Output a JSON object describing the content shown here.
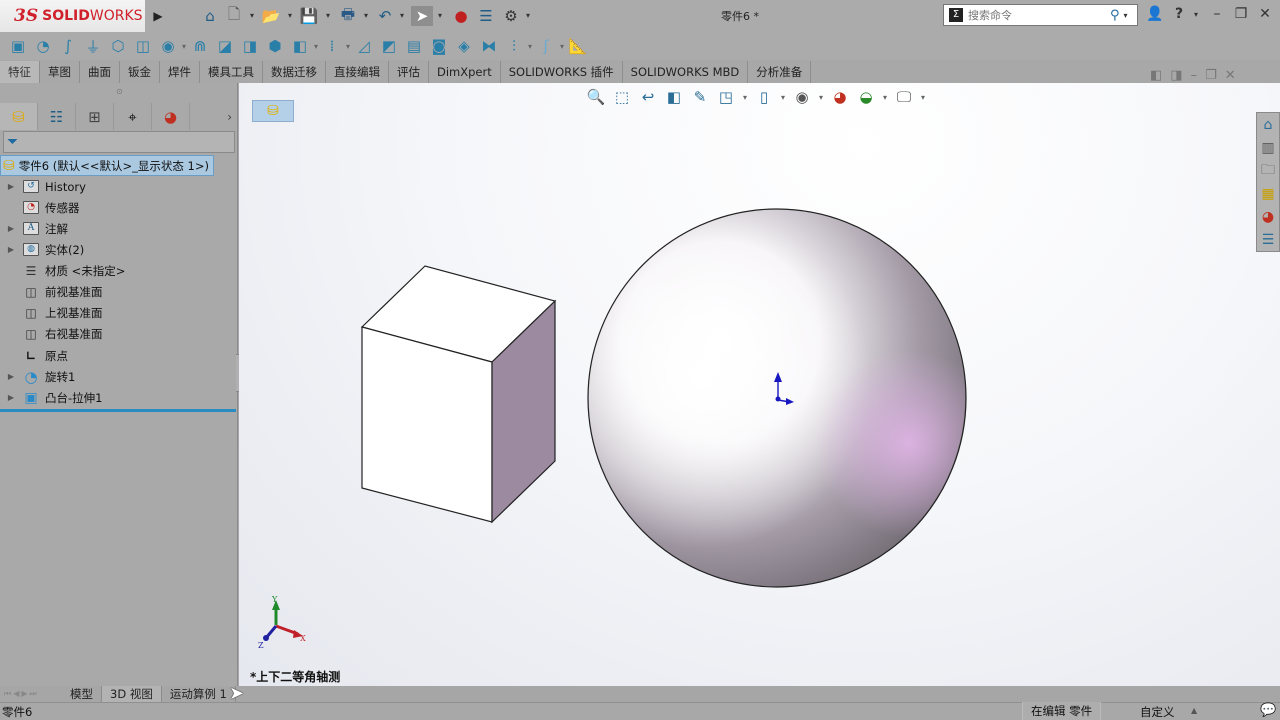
{
  "app": {
    "logo_prefix": "3S",
    "logo_brand_bold": "SOLID",
    "logo_brand_rest": "WORKS",
    "document_title": "零件6 *"
  },
  "quick_access": {
    "icons": [
      "home-icon",
      "new-document-icon",
      "open-icon",
      "save-icon",
      "print-icon",
      "undo-icon",
      "select-icon",
      "rebuild-icon",
      "file-properties-icon",
      "options-icon"
    ]
  },
  "search": {
    "placeholder": "搜索命令",
    "value": ""
  },
  "window_controls": {
    "user_icon": "user-icon",
    "help": "?",
    "minimize": "–",
    "restore": "❐",
    "close": "✕"
  },
  "command_manager": {
    "tabs": [
      {
        "label": "特征",
        "active": true
      },
      {
        "label": "草图"
      },
      {
        "label": "曲面"
      },
      {
        "label": "钣金"
      },
      {
        "label": "焊件"
      },
      {
        "label": "模具工具"
      },
      {
        "label": "数据迁移"
      },
      {
        "label": "直接编辑"
      },
      {
        "label": "评估"
      },
      {
        "label": "DimXpert"
      },
      {
        "label": "SOLIDWORKS 插件"
      },
      {
        "label": "SOLIDWORKS MBD"
      },
      {
        "label": "分析准备"
      }
    ]
  },
  "feature_manager": {
    "panel_tabs": [
      "feature-manager-tab",
      "property-manager-tab",
      "configuration-manager-tab",
      "dimxpert-manager-tab",
      "display-manager-tab"
    ],
    "root": "零件6  (默认<<默认>_显示状态 1>)",
    "items": [
      {
        "label": "History",
        "expandable": true,
        "icon": "history-folder-icon"
      },
      {
        "label": "传感器",
        "expandable": false,
        "icon": "sensors-folder-icon"
      },
      {
        "label": "注解",
        "expandable": true,
        "icon": "annotations-folder-icon"
      },
      {
        "label": "实体(2)",
        "expandable": true,
        "icon": "solid-bodies-folder-icon"
      },
      {
        "label": "材质 <未指定>",
        "expandable": false,
        "icon": "material-icon"
      },
      {
        "label": "前视基准面",
        "expandable": false,
        "icon": "plane-icon"
      },
      {
        "label": "上视基准面",
        "expandable": false,
        "icon": "plane-icon"
      },
      {
        "label": "右视基准面",
        "expandable": false,
        "icon": "plane-icon"
      },
      {
        "label": "原点",
        "expandable": false,
        "icon": "origin-icon"
      },
      {
        "label": "旋转1",
        "expandable": true,
        "icon": "revolve-icon"
      },
      {
        "label": "凸台-拉伸1",
        "expandable": true,
        "icon": "extrude-icon"
      }
    ]
  },
  "viewport": {
    "view_orientation": "*上下二等角轴测",
    "triad": {
      "x": "X",
      "y": "Y",
      "z": "Z"
    },
    "colors": {
      "cube_side": "#9c8aa0",
      "sphere_tint": "#d7b6dd",
      "triad_x": "#c0202a",
      "triad_y": "#1f8a2a",
      "triad_z": "#2020a0"
    }
  },
  "bottom_tabs": [
    {
      "label": "模型",
      "active": false
    },
    {
      "label": "3D 视图",
      "active": true
    },
    {
      "label": "运动算例 1",
      "active": false
    }
  ],
  "status": {
    "left": "零件6",
    "editing": "在编辑 零件",
    "units": "自定义"
  }
}
